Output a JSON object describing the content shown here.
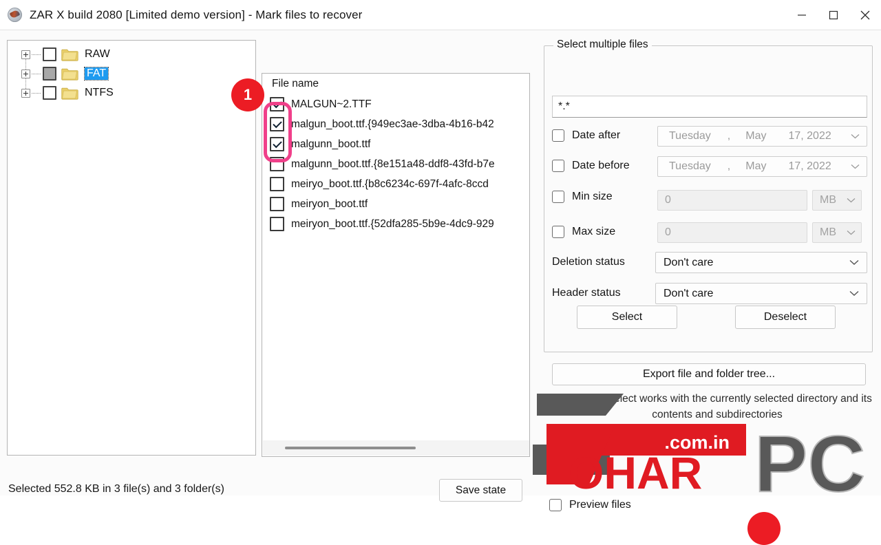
{
  "window": {
    "title": "ZAR X build 2080 [Limited demo version] - Mark files to recover",
    "app_icon": "zar-app-icon",
    "minimize": "minimize-icon",
    "maximize": "maximize-icon",
    "close": "close-icon"
  },
  "tree": {
    "items": [
      {
        "label": "RAW",
        "check_state": "unchecked",
        "selected": false,
        "expandable": true
      },
      {
        "label": "FAT",
        "check_state": "partial",
        "selected": true,
        "expandable": true
      },
      {
        "label": "NTFS",
        "check_state": "unchecked",
        "selected": false,
        "expandable": true
      }
    ],
    "selection_color": "#1e9bf0"
  },
  "file_list": {
    "column_header": "File name",
    "rows": [
      {
        "name": "MALGUN~2.TTF",
        "checked": true
      },
      {
        "name": "malgun_boot.ttf.{949ec3ae-3dba-4b16-b42",
        "checked": true
      },
      {
        "name": "malgunn_boot.ttf",
        "checked": true
      },
      {
        "name": "malgunn_boot.ttf.{8e151a48-ddf8-43fd-b7e",
        "checked": false
      },
      {
        "name": "meiryo_boot.ttf.{b8c6234c-697f-4afc-8ccd",
        "checked": false
      },
      {
        "name": "meiryon_boot.ttf",
        "checked": false
      },
      {
        "name": "meiryon_boot.ttf.{52dfa285-5b9e-4dc9-929",
        "checked": false
      }
    ]
  },
  "status": {
    "text": "Selected 552.8 KB in 3 file(s) and 3 folder(s)",
    "save_state_label": "Save state"
  },
  "select_panel": {
    "legend": "Select multiple files",
    "mask_value": "*.*",
    "date_after": {
      "label": "Date after",
      "checked": false,
      "day": "Tuesday",
      "comma": ",",
      "month": "May",
      "date": "17, 2022"
    },
    "date_before": {
      "label": "Date before",
      "checked": false,
      "day": "Tuesday",
      "comma": ",",
      "month": "May",
      "date": "17, 2022"
    },
    "min_size": {
      "label": "Min size",
      "checked": false,
      "value": "0",
      "unit": "MB"
    },
    "max_size": {
      "label": "Max size",
      "checked": false,
      "value": "0",
      "unit": "MB"
    },
    "deletion_status": {
      "label": "Deletion status",
      "value": "Don't care"
    },
    "header_status": {
      "label": "Header status",
      "value": "Don't care"
    },
    "select_label": "Select",
    "deselect_label": "Deselect"
  },
  "export": {
    "button_label": "Export file and folder tree...",
    "hint": "Select/Deselect works with the currently selected directory and its contents and subdirectories"
  },
  "preview": {
    "label": "Preview files",
    "checked": false
  },
  "annotations": {
    "badge_one": "1",
    "highlight_color": "#f0408a",
    "badge_color": "#ec1c24"
  },
  "watermark": {
    "brand": "TOHAR",
    "domain": ".com.in",
    "suffix": "PC",
    "red": "#e01b22",
    "gray": "#595959"
  }
}
